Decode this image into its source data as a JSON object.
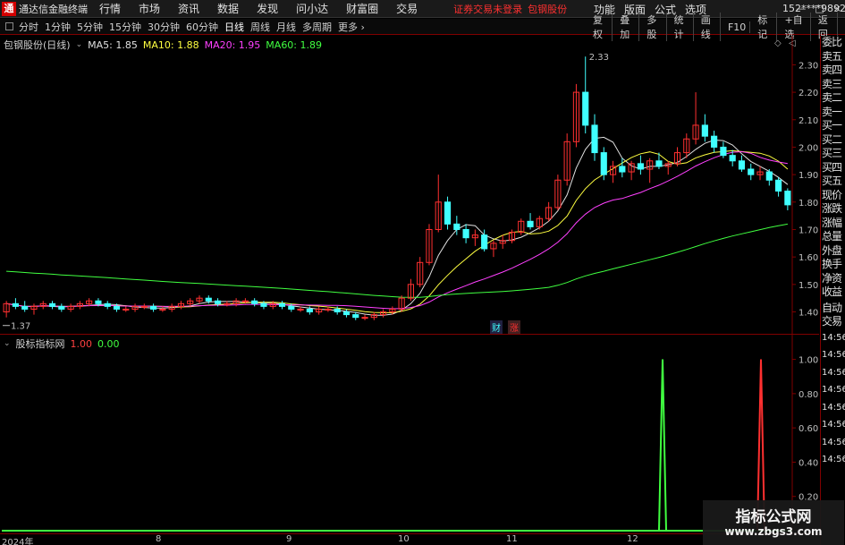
{
  "menubar": {
    "logo": "通",
    "app_title": "通达信金融终端",
    "items": [
      "行情",
      "市场",
      "资讯",
      "数据",
      "发现",
      "问小达",
      "财富圈",
      "交易"
    ],
    "warning": "证券交易未登录",
    "stock_name": "包钢股份",
    "right_items": [
      "功能",
      "版面",
      "公式",
      "选项"
    ],
    "user_id": "152****9892",
    "window_buttons": [
      "—",
      "□",
      "×"
    ]
  },
  "toolbar": {
    "periods": [
      "分时",
      "1分钟",
      "5分钟",
      "15分钟",
      "30分钟",
      "60分钟",
      "日线",
      "周线",
      "月线",
      "多周期",
      "更多 ›"
    ],
    "active_period": "日线",
    "right_items": [
      "复权",
      "叠加",
      "多股",
      "统计",
      "画线",
      "F10",
      "标记",
      "+自选",
      "返回"
    ]
  },
  "main_chart": {
    "stock_label": "包钢股份(日线)",
    "ma5_label": "MA5: 1.85",
    "ma10_label": "MA10: 1.88",
    "ma20_label": "MA20: 1.95",
    "ma60_label": "MA60: 1.89",
    "high_label": "2.33",
    "low_label": "1.37",
    "event_labels": [
      "财",
      "涨"
    ]
  },
  "indicator": {
    "name": "股标指标网",
    "value1": "1.00",
    "value2": "0.00"
  },
  "date_axis": [
    "2024年",
    "8",
    "9",
    "10",
    "11",
    "12"
  ],
  "side_panel": {
    "top_items": [
      "委比",
      "卖五",
      "卖四",
      "卖三",
      "卖二",
      "卖一",
      "买一",
      "买二",
      "买三",
      "买四",
      "买五",
      "现价",
      "涨跌",
      "涨幅",
      "总量",
      "外盘",
      "换手",
      "净资",
      "收益"
    ],
    "mid_items": [
      "自动",
      "交易"
    ],
    "times": [
      "14:56",
      "14:56",
      "14:56",
      "14:56",
      "14:56",
      "14:56",
      "14:56",
      "14:56"
    ]
  },
  "watermark": {
    "title": "指标公式网",
    "url": "www.zbgs3.com"
  },
  "chart_data": [
    {
      "type": "candlestick",
      "title": "包钢股份(日线)",
      "ylim": [
        1.33,
        2.36
      ],
      "yticks": [
        1.4,
        1.5,
        1.6,
        1.7,
        1.8,
        1.9,
        2.0,
        2.1,
        2.2,
        2.3
      ],
      "x_labels": [
        "2024年",
        "8",
        "9",
        "10",
        "11",
        "12"
      ],
      "candles": [
        [
          1.4,
          1.44,
          1.38,
          1.43
        ],
        [
          1.43,
          1.45,
          1.41,
          1.42
        ],
        [
          1.42,
          1.44,
          1.4,
          1.41
        ],
        [
          1.41,
          1.43,
          1.39,
          1.42
        ],
        [
          1.42,
          1.44,
          1.41,
          1.43
        ],
        [
          1.43,
          1.44,
          1.41,
          1.42
        ],
        [
          1.42,
          1.43,
          1.4,
          1.41
        ],
        [
          1.41,
          1.43,
          1.4,
          1.42
        ],
        [
          1.42,
          1.44,
          1.41,
          1.43
        ],
        [
          1.43,
          1.45,
          1.42,
          1.44
        ],
        [
          1.44,
          1.45,
          1.42,
          1.43
        ],
        [
          1.43,
          1.44,
          1.41,
          1.42
        ],
        [
          1.42,
          1.43,
          1.4,
          1.41
        ],
        [
          1.41,
          1.42,
          1.4,
          1.41
        ],
        [
          1.41,
          1.43,
          1.4,
          1.42
        ],
        [
          1.42,
          1.43,
          1.41,
          1.42
        ],
        [
          1.42,
          1.43,
          1.4,
          1.41
        ],
        [
          1.41,
          1.42,
          1.4,
          1.41
        ],
        [
          1.41,
          1.43,
          1.4,
          1.42
        ],
        [
          1.42,
          1.44,
          1.41,
          1.43
        ],
        [
          1.43,
          1.45,
          1.42,
          1.44
        ],
        [
          1.44,
          1.46,
          1.43,
          1.45
        ],
        [
          1.45,
          1.46,
          1.43,
          1.44
        ],
        [
          1.44,
          1.45,
          1.42,
          1.43
        ],
        [
          1.43,
          1.44,
          1.42,
          1.43
        ],
        [
          1.43,
          1.45,
          1.42,
          1.44
        ],
        [
          1.44,
          1.45,
          1.43,
          1.44
        ],
        [
          1.44,
          1.45,
          1.42,
          1.43
        ],
        [
          1.43,
          1.44,
          1.41,
          1.42
        ],
        [
          1.42,
          1.44,
          1.41,
          1.43
        ],
        [
          1.43,
          1.44,
          1.41,
          1.42
        ],
        [
          1.42,
          1.43,
          1.4,
          1.41
        ],
        [
          1.41,
          1.42,
          1.4,
          1.41
        ],
        [
          1.41,
          1.42,
          1.39,
          1.4
        ],
        [
          1.4,
          1.42,
          1.39,
          1.41
        ],
        [
          1.41,
          1.42,
          1.4,
          1.41
        ],
        [
          1.41,
          1.42,
          1.39,
          1.4
        ],
        [
          1.4,
          1.41,
          1.38,
          1.39
        ],
        [
          1.39,
          1.4,
          1.37,
          1.38
        ],
        [
          1.38,
          1.39,
          1.37,
          1.38
        ],
        [
          1.38,
          1.4,
          1.37,
          1.39
        ],
        [
          1.39,
          1.41,
          1.38,
          1.4
        ],
        [
          1.4,
          1.42,
          1.39,
          1.41
        ],
        [
          1.41,
          1.46,
          1.4,
          1.45
        ],
        [
          1.45,
          1.52,
          1.44,
          1.5
        ],
        [
          1.5,
          1.6,
          1.49,
          1.58
        ],
        [
          1.58,
          1.72,
          1.57,
          1.7
        ],
        [
          1.7,
          1.9,
          1.69,
          1.8
        ],
        [
          1.8,
          1.82,
          1.7,
          1.72
        ],
        [
          1.72,
          1.75,
          1.68,
          1.7
        ],
        [
          1.7,
          1.72,
          1.65,
          1.67
        ],
        [
          1.67,
          1.7,
          1.64,
          1.68
        ],
        [
          1.68,
          1.7,
          1.62,
          1.63
        ],
        [
          1.63,
          1.66,
          1.6,
          1.65
        ],
        [
          1.65,
          1.68,
          1.63,
          1.66
        ],
        [
          1.66,
          1.7,
          1.65,
          1.69
        ],
        [
          1.69,
          1.74,
          1.68,
          1.73
        ],
        [
          1.73,
          1.76,
          1.7,
          1.71
        ],
        [
          1.71,
          1.75,
          1.7,
          1.74
        ],
        [
          1.74,
          1.8,
          1.73,
          1.78
        ],
        [
          1.78,
          1.9,
          1.77,
          1.88
        ],
        [
          1.88,
          2.05,
          1.86,
          2.02
        ],
        [
          2.02,
          2.23,
          2.0,
          2.2
        ],
        [
          2.2,
          2.33,
          2.05,
          2.08
        ],
        [
          2.08,
          2.12,
          1.95,
          1.98
        ],
        [
          1.98,
          2.0,
          1.88,
          1.9
        ],
        [
          1.9,
          1.95,
          1.87,
          1.93
        ],
        [
          1.93,
          1.96,
          1.89,
          1.91
        ],
        [
          1.91,
          1.95,
          1.88,
          1.94
        ],
        [
          1.94,
          1.97,
          1.9,
          1.92
        ],
        [
          1.92,
          1.96,
          1.87,
          1.95
        ],
        [
          1.95,
          1.98,
          1.92,
          1.93
        ],
        [
          1.93,
          1.95,
          1.9,
          1.94
        ],
        [
          1.94,
          2.0,
          1.93,
          1.98
        ],
        [
          1.98,
          2.05,
          1.96,
          2.03
        ],
        [
          2.03,
          2.2,
          2.01,
          2.08
        ],
        [
          2.08,
          2.12,
          2.02,
          2.04
        ],
        [
          2.04,
          2.06,
          1.98,
          2.0
        ],
        [
          2.0,
          2.02,
          1.96,
          1.97
        ],
        [
          1.97,
          1.99,
          1.93,
          1.95
        ],
        [
          1.95,
          1.97,
          1.91,
          1.92
        ],
        [
          1.92,
          1.94,
          1.88,
          1.9
        ],
        [
          1.9,
          1.93,
          1.88,
          1.91
        ],
        [
          1.91,
          1.92,
          1.86,
          1.88
        ],
        [
          1.88,
          1.89,
          1.82,
          1.84
        ],
        [
          1.84,
          1.85,
          1.77,
          1.79
        ]
      ],
      "ma_series": [
        {
          "name": "MA5",
          "color": "#e0e0e0",
          "last": 1.85
        },
        {
          "name": "MA10",
          "color": "#ffff40",
          "last": 1.88
        },
        {
          "name": "MA20",
          "color": "#ff40ff",
          "last": 1.95
        },
        {
          "name": "MA60",
          "color": "#40ff40",
          "last": 1.89
        }
      ]
    },
    {
      "type": "line",
      "title": "股标指标网",
      "ylim": [
        0,
        1.05
      ],
      "yticks": [
        0.2,
        0.4,
        0.6,
        0.8,
        1.0
      ],
      "signals": [
        {
          "index": 75,
          "value": 1.0,
          "color": "#40ff40"
        },
        {
          "index": 85,
          "value": 1.0,
          "color": "#ff3030"
        }
      ]
    }
  ],
  "colors": {
    "up": "#ff3030",
    "down": "#40ffff",
    "border": "#800000",
    "axis_text": "#c0c0c0"
  }
}
